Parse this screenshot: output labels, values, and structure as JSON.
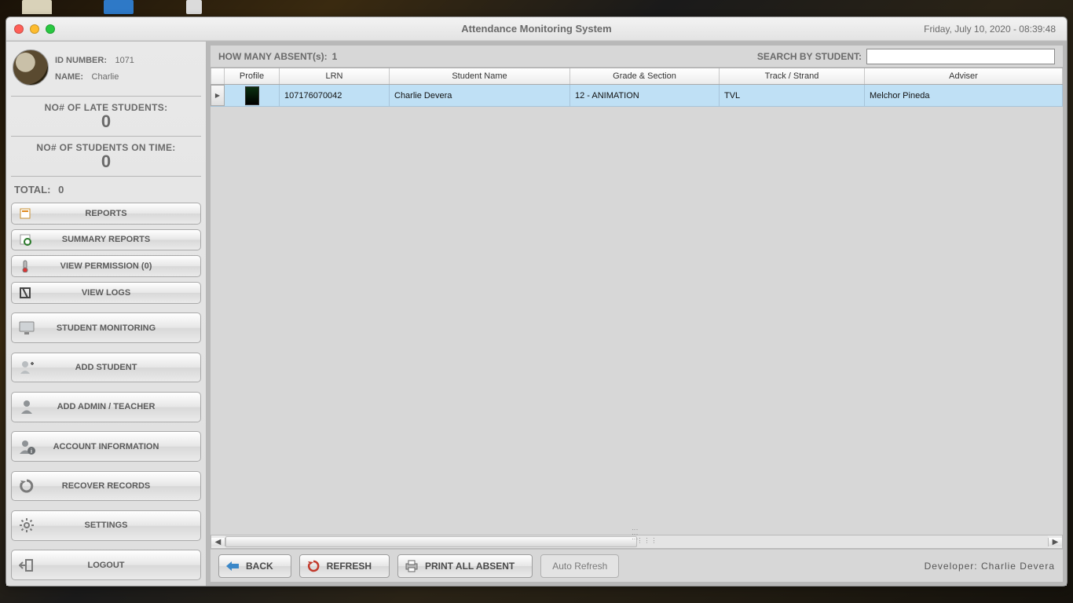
{
  "window": {
    "title": "Attendance Monitoring System",
    "datetime": "Friday, July  10, 2020 - 08:39:48"
  },
  "user": {
    "id_label": "ID NUMBER:",
    "id_value": "1071",
    "name_label": "NAME:",
    "name_value": "Charlie"
  },
  "stats": {
    "late_label": "NO# OF LATE STUDENTS:",
    "late_value": "0",
    "ontime_label": "NO# OF STUDENTS ON TIME:",
    "ontime_value": "0",
    "total_label": "TOTAL:",
    "total_value": "0"
  },
  "nav": {
    "reports": "REPORTS",
    "summary": "SUMMARY REPORTS",
    "permission": "VIEW PERMISSION (0)",
    "logs": "VIEW LOGS",
    "monitoring": "STUDENT MONITORING",
    "add_student": "ADD STUDENT",
    "add_admin": "ADD ADMIN / TEACHER",
    "account": "ACCOUNT INFORMATION",
    "recover": "RECOVER RECORDS",
    "settings": "SETTINGS",
    "logout": "LOGOUT"
  },
  "toolbar": {
    "absent_label": "HOW MANY ABSENT(s):",
    "absent_value": "1",
    "search_label": "SEARCH BY STUDENT:"
  },
  "columns": {
    "profile": "Profile",
    "lrn": "LRN",
    "name": "Student Name",
    "grade": "Grade & Section",
    "track": "Track / Strand",
    "adviser": "Adviser"
  },
  "rows": [
    {
      "lrn": "107176070042",
      "name": "Charlie Devera",
      "grade": "12 - ANIMATION",
      "track": "TVL",
      "adviser": "Melchor Pineda"
    }
  ],
  "footer": {
    "back": "BACK",
    "refresh": "REFRESH",
    "print": "PRINT ALL ABSENT",
    "auto": "Auto Refresh",
    "developer": "Developer: Charlie Devera"
  }
}
